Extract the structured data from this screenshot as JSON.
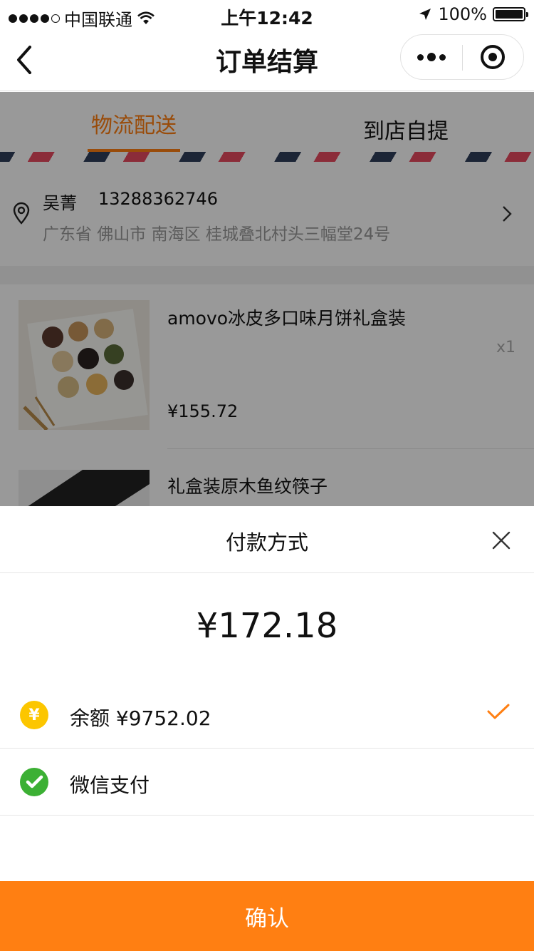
{
  "status_bar": {
    "carrier": "中国联通",
    "time": "上午12:42",
    "battery": "100%"
  },
  "nav": {
    "title": "订单结算",
    "back_icon": "chevron-left-icon",
    "more_icon": "more-dots-icon",
    "close_icon": "target-circle-icon"
  },
  "delivery_tabs": [
    {
      "label": "物流配送",
      "active": true
    },
    {
      "label": "到店自提",
      "active": false
    }
  ],
  "address": {
    "name": "吴菁",
    "phone": "13288362746",
    "detail": "广东省 佛山市 南海区 桂城叠北村头三幅堂24号"
  },
  "goods": [
    {
      "title": "amovo冰皮多口味月饼礼盒装",
      "qty": "x1",
      "price": "¥155.72"
    },
    {
      "title": "礼盒装原木鱼纹筷子"
    }
  ],
  "payment_sheet": {
    "title": "付款方式",
    "amount": "¥172.18",
    "methods": [
      {
        "icon": "yuan-icon",
        "icon_glyph": "¥",
        "label": "余额 ¥9752.02",
        "selected": true
      },
      {
        "icon": "wechat-pay-icon",
        "label": "微信支付",
        "selected": false
      }
    ],
    "confirm_label": "确认"
  },
  "colors": {
    "accent": "#ff7f12",
    "yuan_icon": "#fcc600",
    "wechat_green": "#3cb034",
    "stripe_red": "#e84a5f",
    "stripe_navy": "#2f3e5a"
  }
}
